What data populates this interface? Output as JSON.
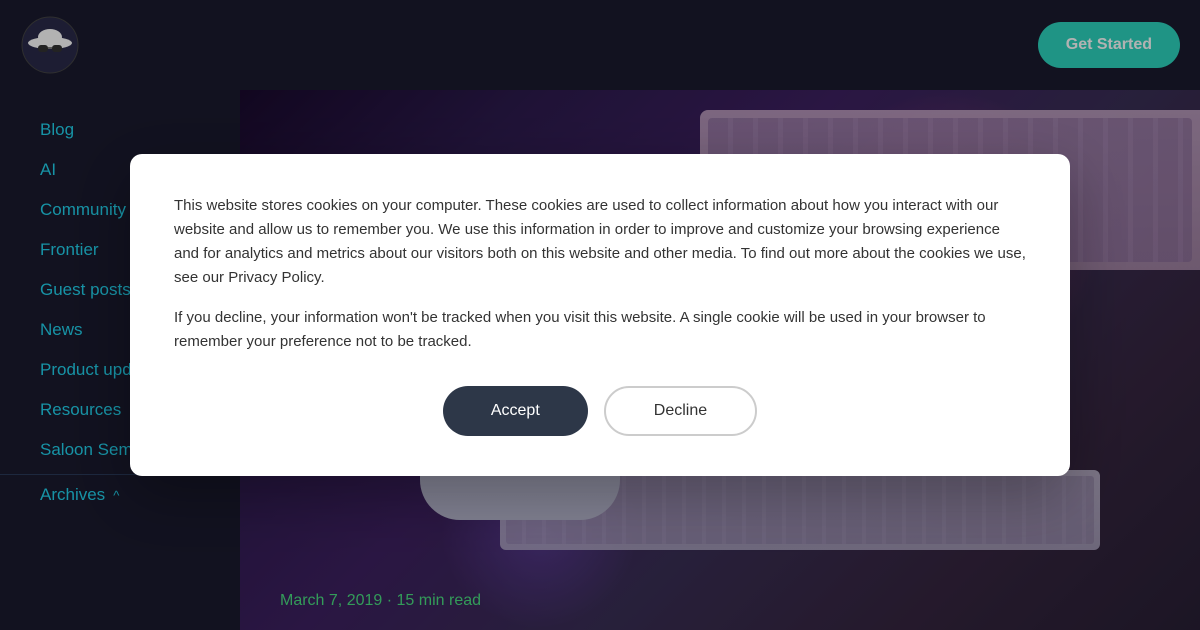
{
  "header": {
    "get_started_label": "Get Started"
  },
  "sidebar": {
    "items": [
      {
        "id": "blog",
        "label": "Blog"
      },
      {
        "id": "ai",
        "label": "AI"
      },
      {
        "id": "community",
        "label": "Community"
      },
      {
        "id": "frontier",
        "label": "Frontier"
      },
      {
        "id": "guest-posts",
        "label": "Guest posts"
      },
      {
        "id": "news",
        "label": "News"
      },
      {
        "id": "product-updates",
        "label": "Product updates"
      },
      {
        "id": "resources",
        "label": "Resources"
      },
      {
        "id": "saloon-seminars",
        "label": "Saloon Seminars"
      }
    ],
    "archives": {
      "label": "Archives",
      "chevron": "^"
    }
  },
  "hero": {
    "date": "March 7, 2019",
    "read_time": "15 min read",
    "date_separator": "·"
  },
  "cookie_modal": {
    "text1": "This website stores cookies on your computer. These cookies are used to collect information about how you interact with our website and allow us to remember you. We use this information in order to improve and customize your browsing experience and for analytics and metrics about our visitors both on this website and other media. To find out more about the cookies we use, see our Privacy Policy.",
    "text2": "If you decline, your information won't be tracked when you visit this website. A single cookie will be used in your browser to remember your preference not to be tracked.",
    "accept_label": "Accept",
    "decline_label": "Decline"
  }
}
